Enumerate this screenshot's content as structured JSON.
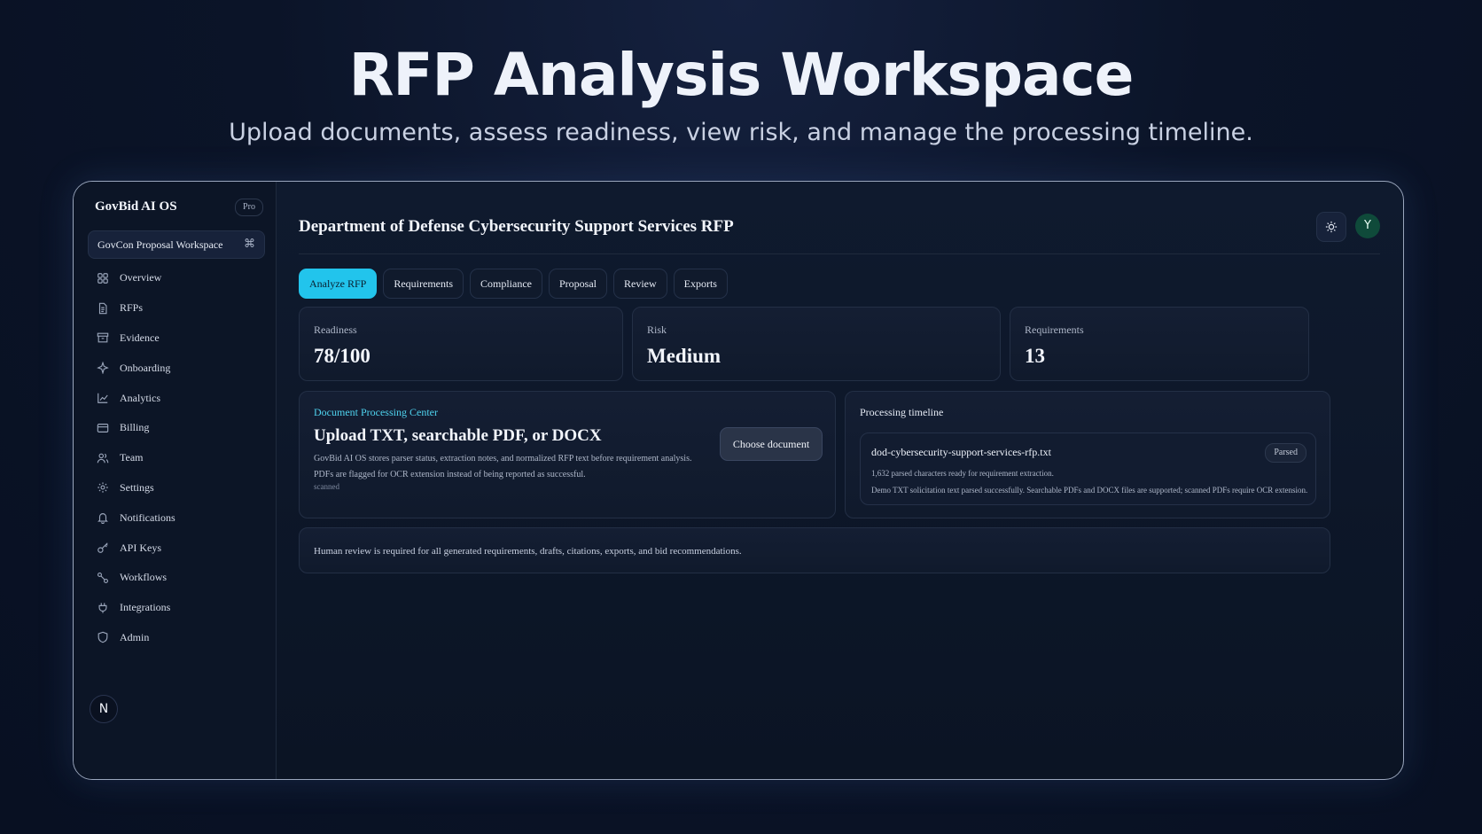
{
  "hero": {
    "title": "RFP Analysis Workspace",
    "subtitle": "Upload documents, assess readiness, view risk, and manage the processing timeline."
  },
  "sidebar": {
    "brand": "GovBid AI OS",
    "badge": "Pro",
    "workspace": "GovCon Proposal Workspace",
    "workspace_shortcut": "⌘",
    "items": [
      {
        "label": "Overview",
        "icon": "grid-icon"
      },
      {
        "label": "RFPs",
        "icon": "document-icon"
      },
      {
        "label": "Evidence",
        "icon": "archive-icon"
      },
      {
        "label": "Onboarding",
        "icon": "sparkle-icon"
      },
      {
        "label": "Analytics",
        "icon": "line-chart-icon"
      },
      {
        "label": "Billing",
        "icon": "credit-card-icon"
      },
      {
        "label": "Team",
        "icon": "users-icon"
      },
      {
        "label": "Settings",
        "icon": "gear-icon"
      },
      {
        "label": "Notifications",
        "icon": "bell-icon"
      },
      {
        "label": "API Keys",
        "icon": "key-icon"
      },
      {
        "label": "Workflows",
        "icon": "workflow-icon"
      },
      {
        "label": "Integrations",
        "icon": "plug-icon"
      },
      {
        "label": "Admin",
        "icon": "shield-icon"
      }
    ],
    "user_initial": "N"
  },
  "header": {
    "title": "Department of Defense Cybersecurity Support Services RFP",
    "avatar_initial": "Y"
  },
  "tabs": [
    {
      "label": "Analyze RFP",
      "active": true
    },
    {
      "label": "Requirements",
      "active": false
    },
    {
      "label": "Compliance",
      "active": false
    },
    {
      "label": "Proposal",
      "active": false
    },
    {
      "label": "Review",
      "active": false
    },
    {
      "label": "Exports",
      "active": false
    }
  ],
  "stats": {
    "readiness": {
      "label": "Readiness",
      "value": "78/100"
    },
    "risk": {
      "label": "Risk",
      "value": "Medium"
    },
    "requirements": {
      "label": "Requirements",
      "value": "13"
    }
  },
  "upload": {
    "kicker": "Document Processing Center",
    "title": "Upload TXT, searchable PDF, or DOCX",
    "description": "GovBid AI OS stores parser status, extraction notes, and normalized RFP text before requirement analysis. PDFs are flagged for OCR extension instead of being reported as successful.",
    "extra": "scanned",
    "button": "Choose document"
  },
  "timeline": {
    "title": "Processing timeline",
    "items": [
      {
        "file": "dod-cybersecurity-support-services-rfp.txt",
        "status": "Parsed",
        "chars": "1,632 parsed characters ready for requirement extraction.",
        "note": "Demo TXT solicitation text parsed successfully. Searchable PDFs and DOCX files are supported; scanned PDFs require OCR extension."
      }
    ]
  },
  "notice": "Human review is required for all generated requirements, drafts, citations, exports, and bid recommendations.",
  "colors": {
    "accent": "#22c4ec",
    "avatar": "#0f4a3a",
    "background": "#0b1428"
  }
}
